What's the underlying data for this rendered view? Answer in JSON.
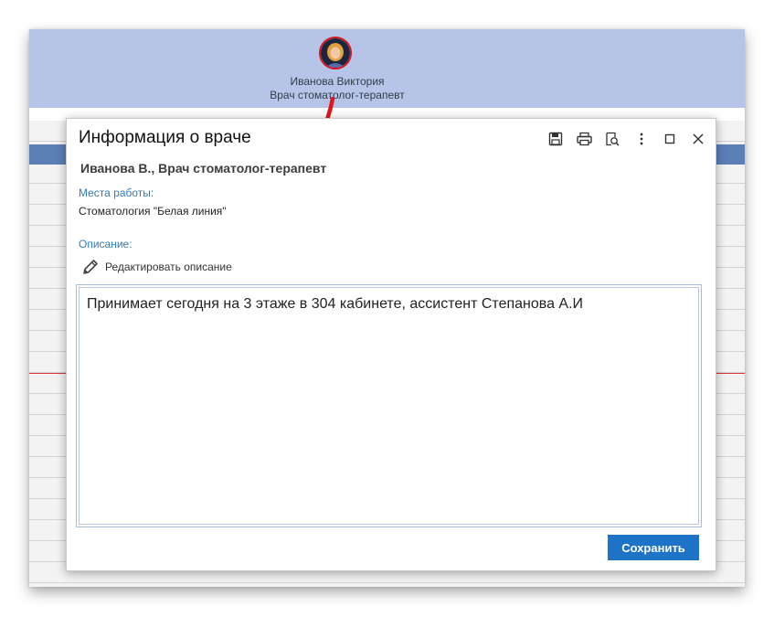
{
  "header": {
    "doctor_name": "Иванова Виктория",
    "doctor_specialty": "Врач стоматолог-терапевт"
  },
  "dialog": {
    "title": "Информация о враче",
    "toolbar_icons": [
      "save-icon",
      "print-icon",
      "preview-icon",
      "more-icon",
      "maximize-icon",
      "close-icon"
    ],
    "doctor_line": "Иванова В., Врач стоматолог-терапевт",
    "workplaces_label": "Места работы:",
    "workplaces_value": "Стоматология \"Белая линия\"",
    "description_label": "Описание:",
    "edit_description_label": "Редактировать описание",
    "description_text": "Принимает сегодня на 3 этаже в 304 кабинете, ассистент Степанова А.И",
    "save_label": "Сохранить"
  },
  "colors": {
    "header_bg": "#b6c5e7",
    "accent": "#1e73c7",
    "label_blue": "#2e7bc4",
    "annotation_red": "#e0141e"
  }
}
